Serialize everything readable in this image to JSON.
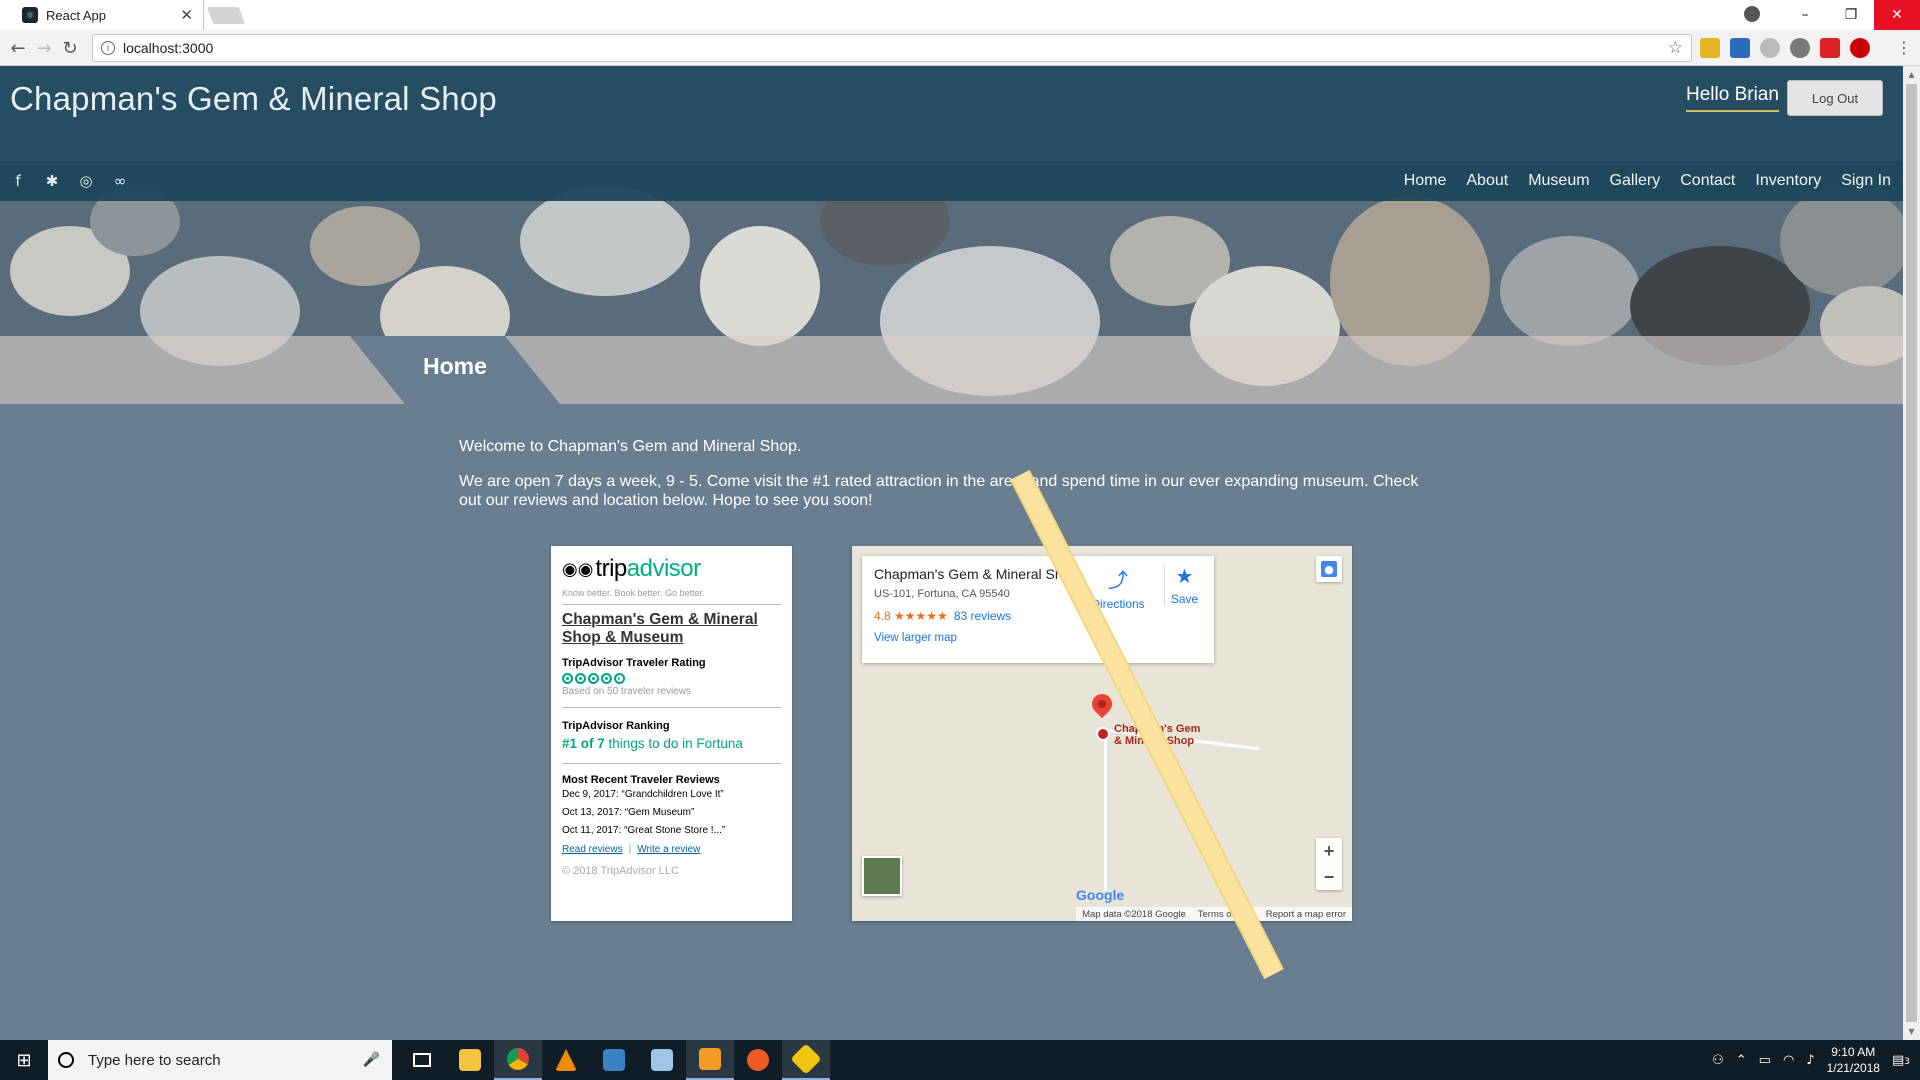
{
  "browser": {
    "tab_title": "React App",
    "tab_close": "✕",
    "url": "localhost:3000",
    "window_controls": [
      "–",
      "❐",
      "✕"
    ]
  },
  "site": {
    "title": "Chapman's Gem & Mineral Shop",
    "greeting": "Hello Brian",
    "logout_label": "Log Out",
    "social_icons": [
      "facebook-icon",
      "yelp-icon",
      "instagram-icon",
      "tripadvisor-icon"
    ],
    "nav": [
      "Home",
      "About",
      "Museum",
      "Gallery",
      "Contact",
      "Inventory",
      "Sign In"
    ],
    "page_heading": "Home",
    "welcome": "Welcome to Chapman's Gem and Mineral Shop.",
    "intro": "We are open 7 days a week, 9 - 5. Come visit the #1 rated attraction in the area, and spend time in our ever expanding museum. Check out our reviews and location below. Hope to see you soon!"
  },
  "tripadvisor": {
    "brand_a": "trip",
    "brand_b": "advisor",
    "tagline": "Know better. Book better. Go better.",
    "name": "Chapman's Gem & Mineral Shop & Museum",
    "rating_heading": "TripAdvisor Traveler Rating",
    "rating_value": 4.5,
    "rating_basis": "Based on 50 traveler reviews",
    "ranking_heading": "TripAdvisor Ranking",
    "ranking_rank": "#1 of 7",
    "ranking_rest": "things to do in Fortuna",
    "reviews_heading": "Most Recent Traveler Reviews",
    "reviews": [
      "Dec 9, 2017: “Grandchildren Love It”",
      "Oct 13, 2017: “Gem Museum”",
      "Oct 11, 2017: “Great Stone Store !...”"
    ],
    "read_reviews": "Read reviews",
    "write_review": "Write a review",
    "copyright": "© 2018 TripAdvisor LLC"
  },
  "map": {
    "place_name": "Chapman's Gem & Mineral Shop",
    "address": "US-101, Fortuna, CA 95540",
    "rating": "4.8 ★★★★★",
    "reviews": "83 reviews",
    "larger_map": "View larger map",
    "directions": "Directions",
    "save": "Save",
    "pin_label_1": "Chapman's Gem",
    "pin_label_2": "& Mineral Shop",
    "zoom_in": "+",
    "zoom_out": "−",
    "google": "Google",
    "footer": [
      "Map data ©2018 Google",
      "Terms of Use",
      "Report a map error"
    ]
  },
  "taskbar": {
    "search_placeholder": "Type here to search",
    "time": "9:10 AM",
    "date": "1/21/2018",
    "notifications": "3"
  }
}
